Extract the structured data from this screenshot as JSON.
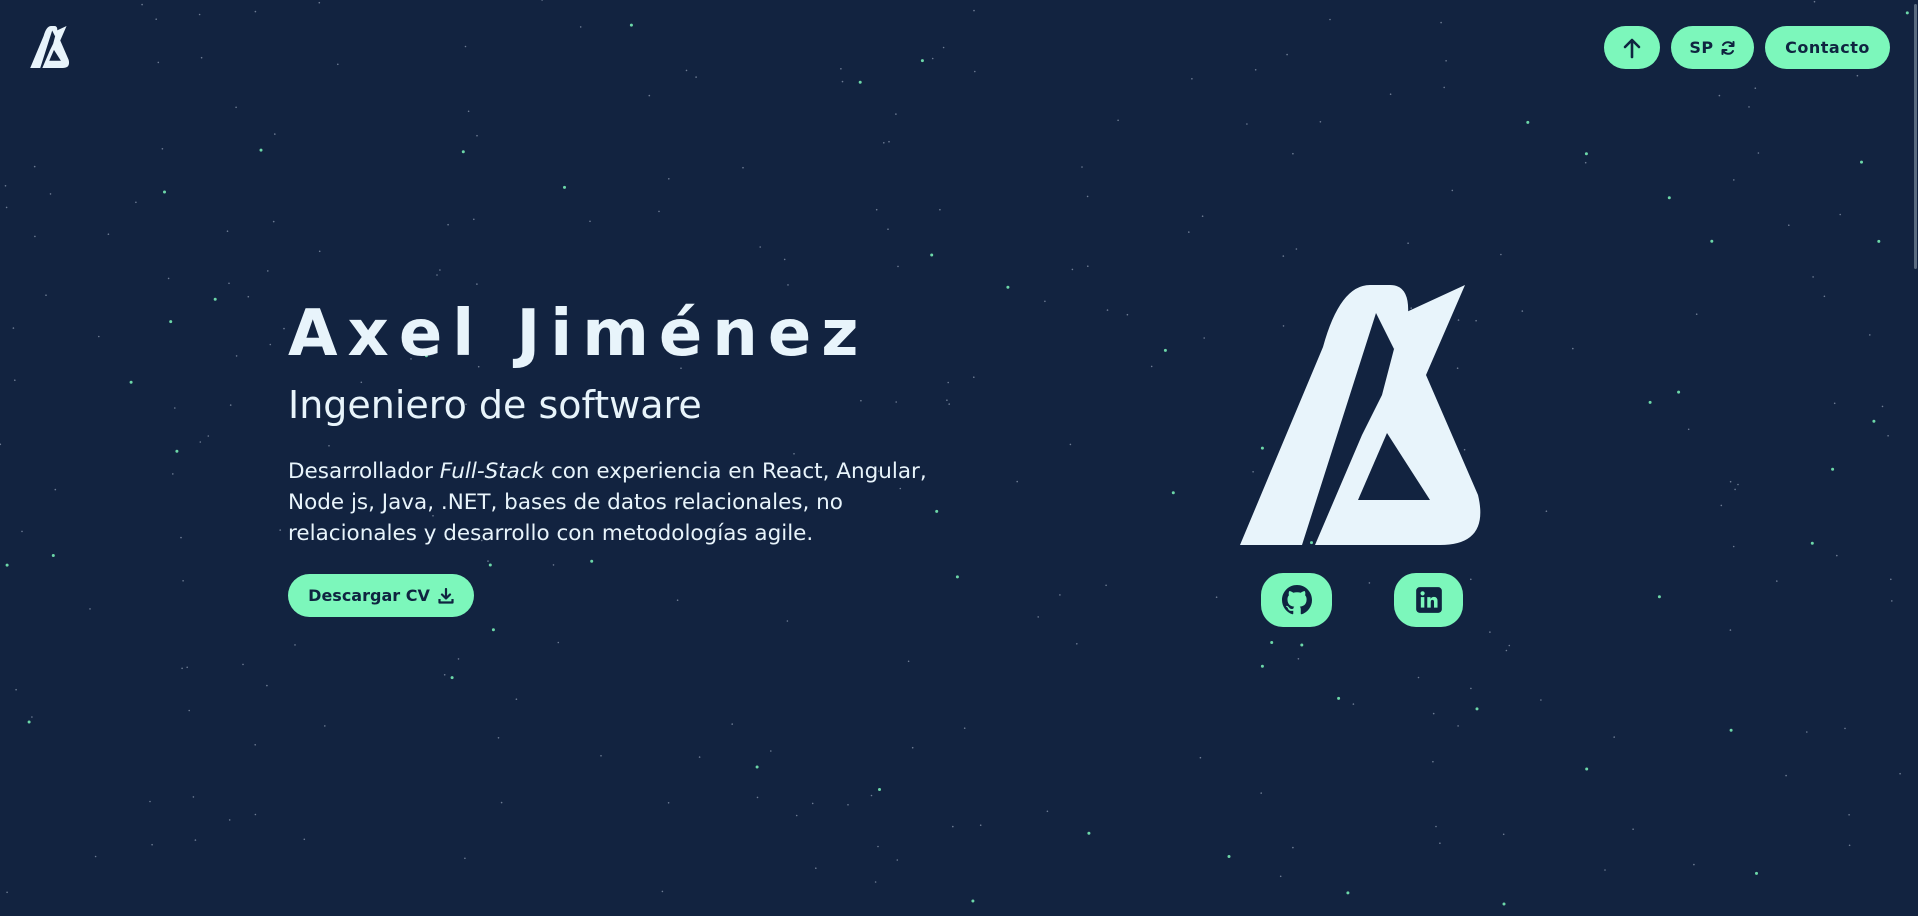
{
  "colors": {
    "background": "#122340",
    "accent": "#7cf7bb",
    "text": "#e8f4fb",
    "dark_text": "#0f2440"
  },
  "header": {
    "logo_icon": "ax-logo-icon",
    "scroll_up_icon": "arrow-up-icon",
    "lang_label": "SP",
    "lang_icon": "sync-icon",
    "contact_label": "Contacto"
  },
  "hero": {
    "name": "Axel Jiménez",
    "role": "Ingeniero de software",
    "desc_before": "Desarrollador ",
    "desc_em": "Full-Stack",
    "desc_after": " con experiencia en React, Angular, Node js, Java, .NET, bases de datos relacionales, no relacionales y desarrollo con metodologías agile.",
    "cv_label": "Descargar CV",
    "cv_icon": "download-icon"
  },
  "social": {
    "github_icon": "github-icon",
    "linkedin_icon": "linkedin-icon"
  }
}
